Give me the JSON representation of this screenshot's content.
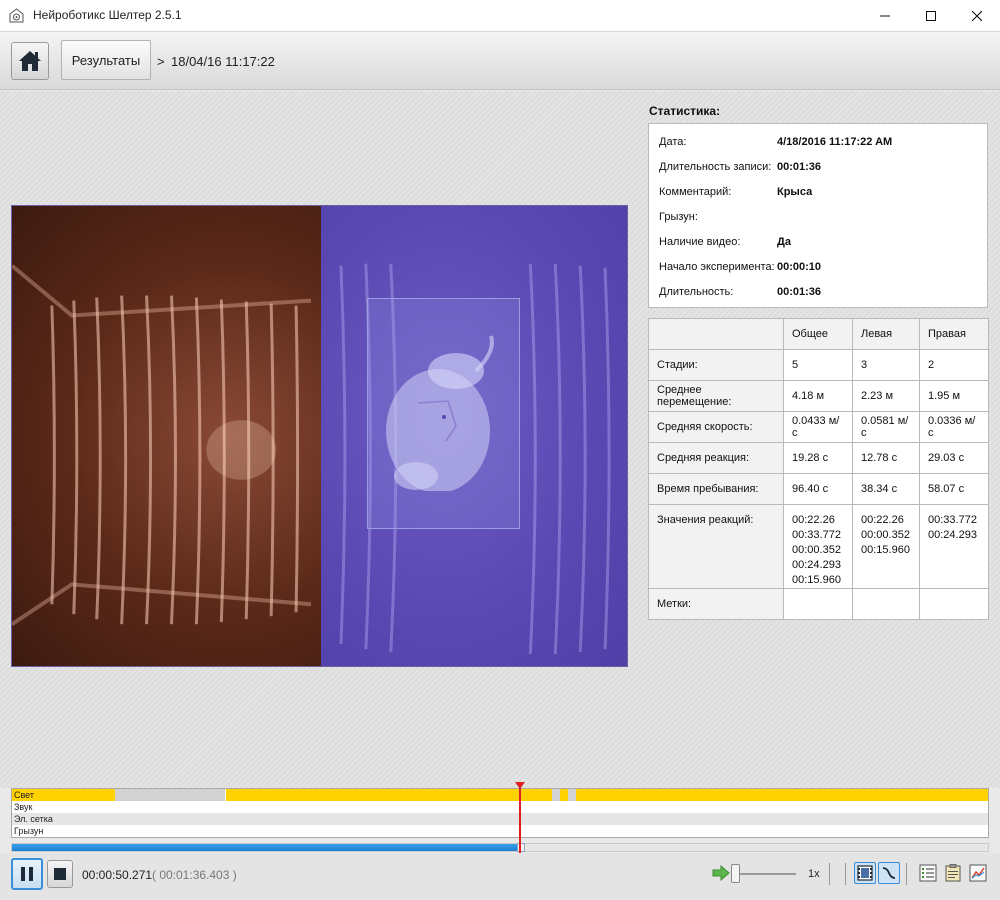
{
  "window": {
    "title": "Нейроботикс Шелтер 2.5.1",
    "minimize_icon": "minimize-icon",
    "maximize_icon": "maximize-icon",
    "close_icon": "close-icon"
  },
  "nav": {
    "home_icon": "home-icon",
    "results_label": "Результаты",
    "separator": ">",
    "session_datetime": "18/04/16 11:17:22"
  },
  "stats": {
    "heading": "Статистика:",
    "rows": [
      {
        "label": "Дата:",
        "value": "4/18/2016 11:17:22 AM"
      },
      {
        "label": "Длительность записи:",
        "value": "00:01:36"
      },
      {
        "label": "Комментарий:",
        "value": "Крыса"
      },
      {
        "label": "Грызун:",
        "value": ""
      },
      {
        "label": "Наличие видео:",
        "value": "Да"
      },
      {
        "label": "Начало эксперимента:",
        "value": "00:00:10"
      },
      {
        "label": "Длительность:",
        "value": "00:01:36"
      }
    ]
  },
  "table": {
    "columns": [
      "",
      "Общее",
      "Левая",
      "Правая"
    ],
    "rows": [
      {
        "label": "Стадии:",
        "total": "5",
        "left": "3",
        "right": "2"
      },
      {
        "label": "Среднее перемещение:",
        "total": "4.18 м",
        "left": "2.23 м",
        "right": "1.95 м"
      },
      {
        "label": "Средняя скорость:",
        "total": "0.0433 м/с",
        "left": "0.0581 м/с",
        "right": "0.0336 м/с"
      },
      {
        "label": "Средняя реакция:",
        "total": "19.28 с",
        "left": "12.78 с",
        "right": "29.03 с"
      },
      {
        "label": "Время пребывания:",
        "total": "96.40 с",
        "left": "38.34 с",
        "right": "58.07 с"
      }
    ],
    "reactions": {
      "label": "Значения реакций:",
      "total": [
        "00:22.26",
        "00:33.772",
        "00:00.352",
        "00:24.293",
        "00:15.960"
      ],
      "left": [
        "00:22.26",
        "00:00.352",
        "00:15.960"
      ],
      "right": [
        "00:33.772",
        "00:24.293"
      ]
    },
    "marks": {
      "label": "Метки:",
      "total": "",
      "left": "",
      "right": ""
    }
  },
  "timeline": {
    "tracks": [
      {
        "label": "Свет"
      },
      {
        "label": "Звук"
      },
      {
        "label": "Эл. сетка"
      },
      {
        "label": "Грызун"
      }
    ],
    "light_segments": [
      {
        "start": 0.0,
        "end": 0.106,
        "state": "on"
      },
      {
        "start": 0.106,
        "end": 0.219,
        "state": "off"
      },
      {
        "start": 0.219,
        "end": 0.553,
        "state": "on"
      },
      {
        "start": 0.553,
        "end": 0.561,
        "state": "off"
      },
      {
        "start": 0.561,
        "end": 0.57,
        "state": "on"
      },
      {
        "start": 0.57,
        "end": 0.578,
        "state": "off"
      },
      {
        "start": 0.578,
        "end": 1.0,
        "state": "on"
      }
    ],
    "light_on_color": "#ffd200",
    "light_off_color": "#d2d2d2",
    "playhead_color": "#e02020"
  },
  "playback": {
    "current_time": "00:00:50.271",
    "total_time": "( 00:01:36.403 )",
    "progress_fraction": 0.5215,
    "speed_label": "1x",
    "pause_icon": "pause-icon",
    "stop_icon": "stop-icon",
    "speed_icon": "fast-forward-arrow-icon",
    "tools": [
      {
        "icon": "video-frame-icon",
        "active": true
      },
      {
        "icon": "track-path-icon",
        "active": true
      },
      {
        "icon": "list-icon",
        "active": false
      },
      {
        "icon": "report-icon",
        "active": false
      },
      {
        "icon": "chart-icon",
        "active": false
      }
    ]
  },
  "colors": {
    "accent": "#3b8fd8",
    "left_zone": "#5a2818",
    "right_zone": "#5a48b2"
  }
}
